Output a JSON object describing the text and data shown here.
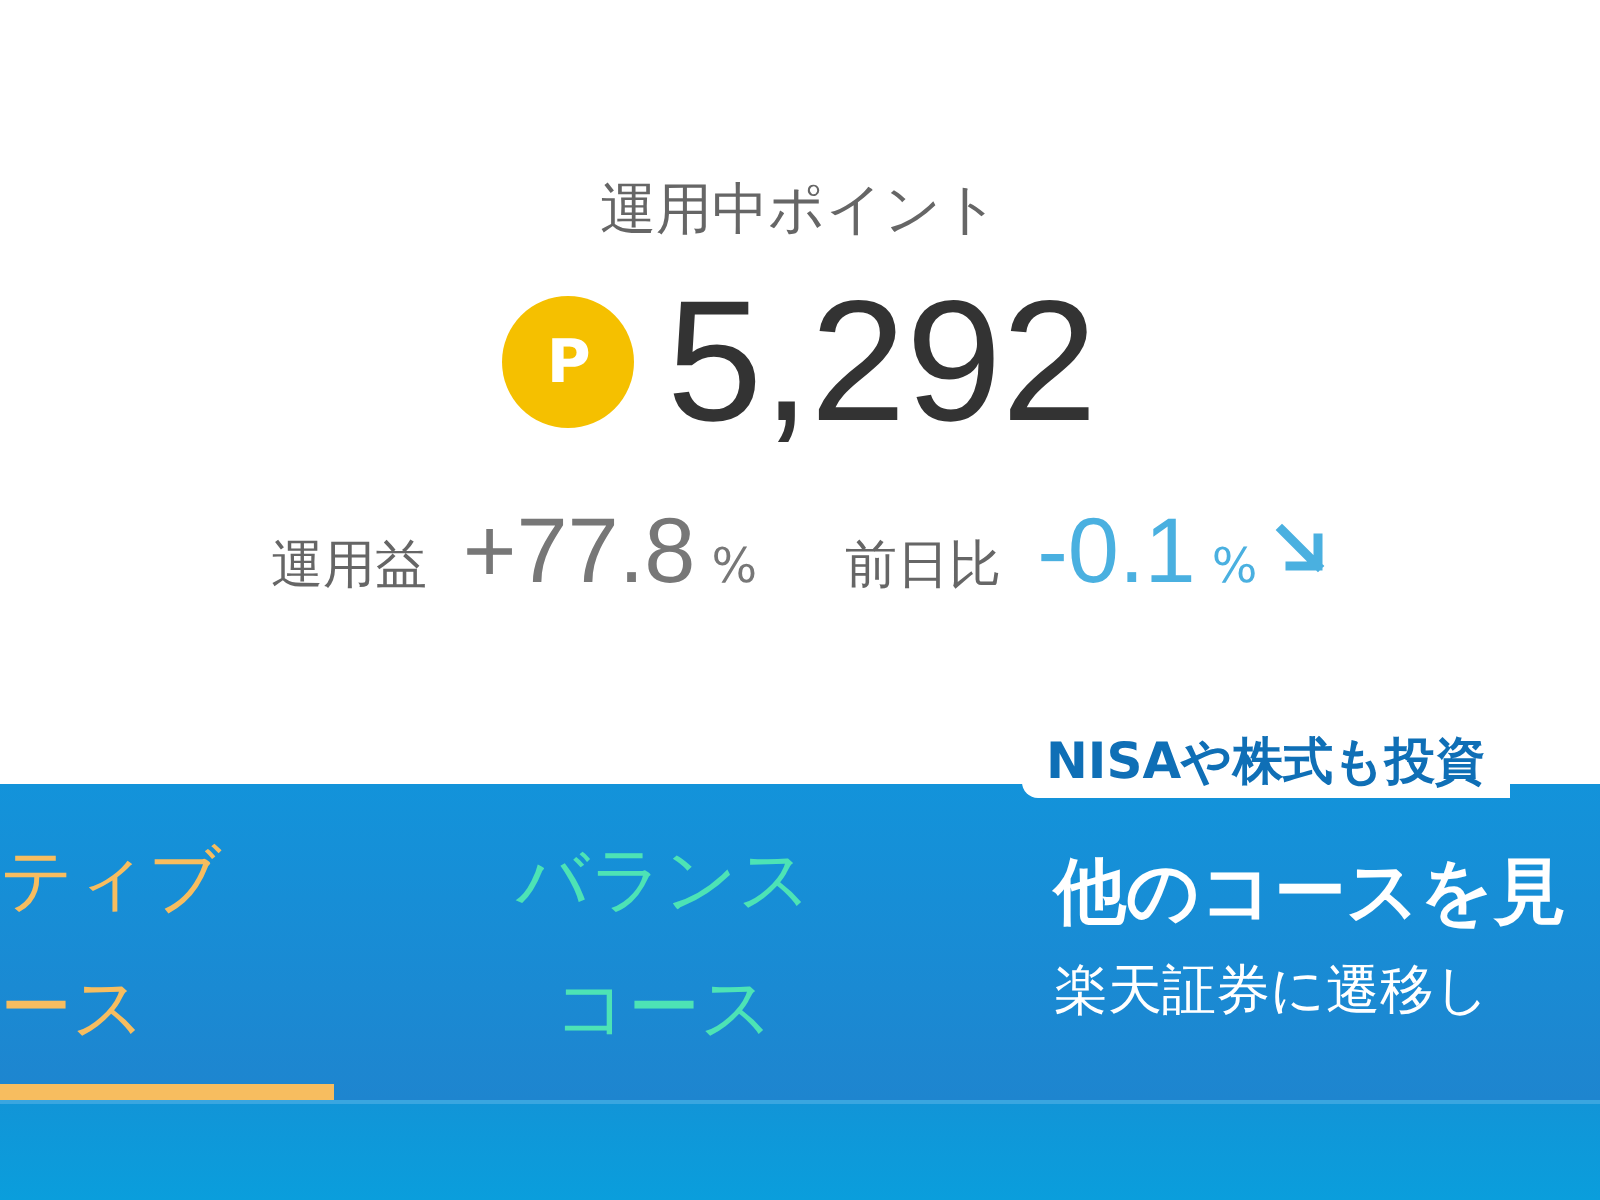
{
  "header": {
    "title": "運用中ポイント",
    "points_icon": "P",
    "points": "5,292"
  },
  "stats": [
    {
      "label": "運用益",
      "value": "+77.8",
      "unit": "%",
      "falling": false
    },
    {
      "label": "前日比",
      "value": "-0.1",
      "unit": "%",
      "falling": true
    }
  ],
  "courses": [
    {
      "kind": "tab",
      "lines": [
        "ティブ",
        "ース"
      ],
      "selected": true
    },
    {
      "kind": "tab",
      "lines": [
        "バランス",
        "コース"
      ],
      "selected": false
    },
    {
      "kind": "link",
      "badge": "NISAや株式も投資",
      "title": "他のコースを見",
      "subtitle": "楽天証券に遷移し"
    }
  ]
}
